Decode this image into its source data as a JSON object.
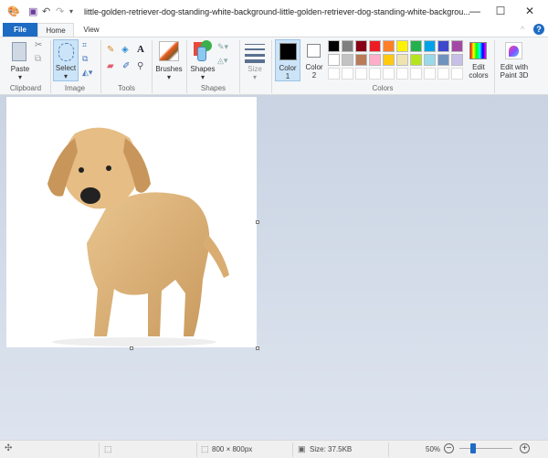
{
  "window": {
    "title": "little-golden-retriever-dog-standing-white-background-little-golden-retriever-dog-standing-white-backgrou...",
    "minimize": "—",
    "maximize": "☐",
    "close": "✕"
  },
  "tabs": [
    {
      "label": "File"
    },
    {
      "label": "Home"
    },
    {
      "label": "View"
    }
  ],
  "ribbon": {
    "clipboard": {
      "paste": "Paste",
      "group": "Clipboard"
    },
    "image": {
      "select": "Select",
      "group": "Image"
    },
    "tools": {
      "group": "Tools"
    },
    "brushes": {
      "label": "Brushes"
    },
    "shapes": {
      "label": "Shapes",
      "group": "Shapes"
    },
    "size": {
      "label": "Size"
    },
    "colors": {
      "color1": "Color",
      "color1_num": "1",
      "color2": "Color",
      "color2_num": "2",
      "group": "Colors",
      "edit": "Edit",
      "edit2": "colors",
      "palette": [
        "#000000",
        "#7f7f7f",
        "#880015",
        "#ed1c24",
        "#ff7f27",
        "#fff200",
        "#22b14c",
        "#00a2e8",
        "#3f48cc",
        "#a349a4",
        "#ffffff",
        "#c3c3c3",
        "#b97a57",
        "#ffaec9",
        "#ffc90e",
        "#efe4b0",
        "#b5e61d",
        "#99d9ea",
        "#7092be",
        "#c8bfe7",
        "#ffffff",
        "#ffffff",
        "#ffffff",
        "#ffffff",
        "#ffffff",
        "#ffffff",
        "#ffffff",
        "#ffffff",
        "#ffffff",
        "#ffffff"
      ],
      "color1_value": "#000000",
      "color2_value": "#ffffff"
    },
    "paint3d": {
      "line1": "Edit with",
      "line2": "Paint 3D"
    }
  },
  "status": {
    "dimensions": "800 × 800px",
    "size": "Size: 37.5KB",
    "zoom": "50%",
    "zoom_percent": 50
  }
}
